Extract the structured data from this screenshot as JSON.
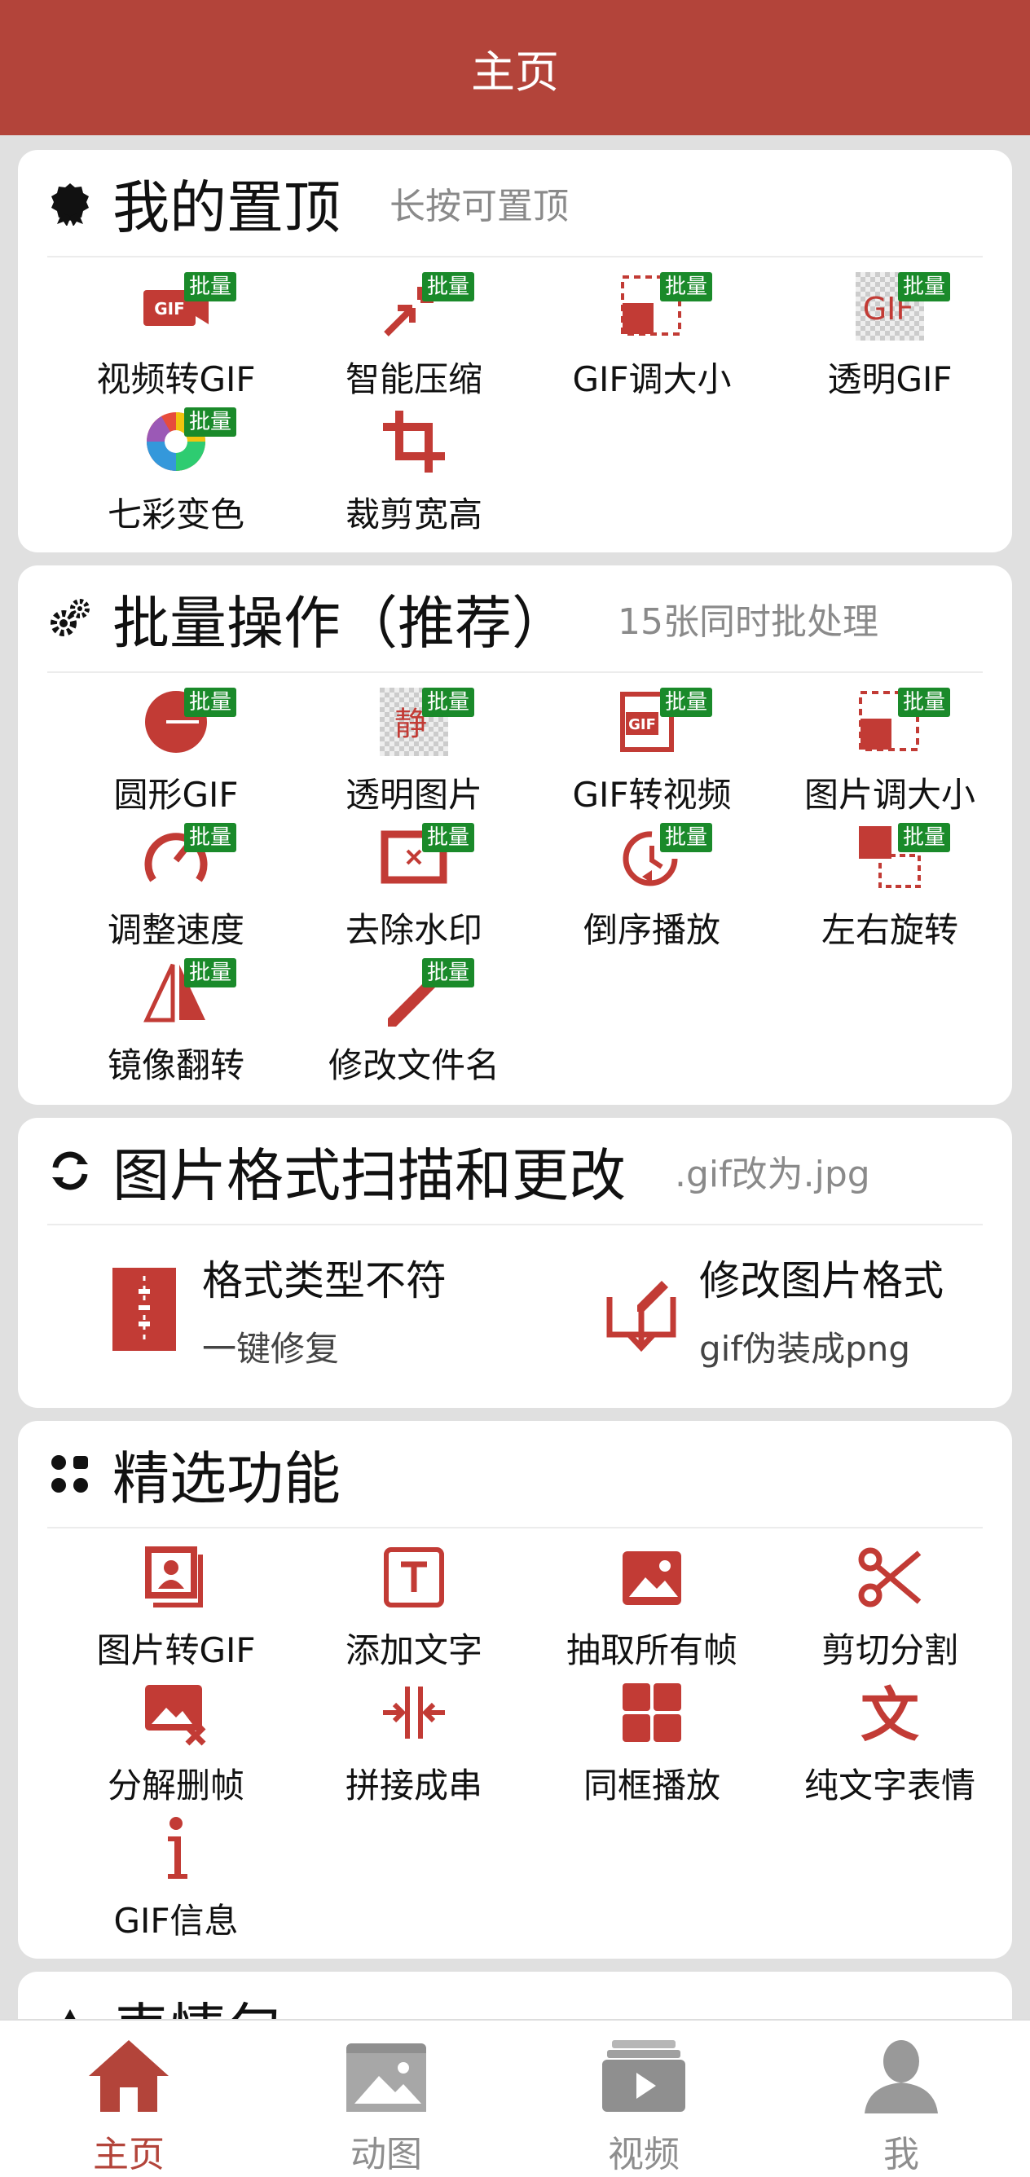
{
  "header": {
    "title": "主页"
  },
  "colors": {
    "accent": "#b3443a",
    "badge": "#1a8a2a"
  },
  "sections": {
    "pinned": {
      "title": "我的置顶",
      "subtitle": "长按可置顶",
      "items": [
        {
          "label": "视频转GIF",
          "badge": "批量",
          "icon": "video-to-gif-icon"
        },
        {
          "label": "智能压缩",
          "badge": "批量",
          "icon": "compress-icon"
        },
        {
          "label": "GIF调大小",
          "badge": "批量",
          "icon": "resize-icon"
        },
        {
          "label": "透明GIF",
          "badge": "批量",
          "icon": "transparent-gif-icon"
        },
        {
          "label": "七彩变色",
          "badge": "批量",
          "icon": "color-wheel-icon"
        },
        {
          "label": "裁剪宽高",
          "badge": "",
          "icon": "crop-icon"
        }
      ]
    },
    "batch": {
      "title": "批量操作（推荐）",
      "subtitle": "15张同时批处理",
      "items": [
        {
          "label": "圆形GIF",
          "badge": "批量",
          "icon": "circle-gif-icon"
        },
        {
          "label": "透明图片",
          "badge": "批量",
          "icon": "transparent-image-icon",
          "glyph": "静"
        },
        {
          "label": "GIF转视频",
          "badge": "批量",
          "icon": "gif-to-video-icon"
        },
        {
          "label": "图片调大小",
          "badge": "批量",
          "icon": "resize-icon"
        },
        {
          "label": "调整速度",
          "badge": "批量",
          "icon": "speed-icon"
        },
        {
          "label": "去除水印",
          "badge": "批量",
          "icon": "remove-watermark-icon"
        },
        {
          "label": "倒序播放",
          "badge": "批量",
          "icon": "reverse-play-icon"
        },
        {
          "label": "左右旋转",
          "badge": "批量",
          "icon": "rotate-icon"
        },
        {
          "label": "镜像翻转",
          "badge": "批量",
          "icon": "mirror-flip-icon"
        },
        {
          "label": "修改文件名",
          "badge": "批量",
          "icon": "rename-icon"
        }
      ]
    },
    "format": {
      "title": "图片格式扫描和更改",
      "subtitle": ".gif改为.jpg",
      "items": [
        {
          "title": "格式类型不符",
          "sub": "一键修复",
          "icon": "zip-file-icon"
        },
        {
          "title": "修改图片格式",
          "sub": "gif伪装成png",
          "icon": "edit-download-icon"
        }
      ]
    },
    "featured": {
      "title": "精选功能",
      "items": [
        {
          "label": "图片转GIF",
          "icon": "photos-icon"
        },
        {
          "label": "添加文字",
          "icon": "text-box-icon"
        },
        {
          "label": "抽取所有帧",
          "icon": "image-icon"
        },
        {
          "label": "剪切分割",
          "icon": "scissors-icon"
        },
        {
          "label": "分解删帧",
          "icon": "image-delete-icon"
        },
        {
          "label": "拼接成串",
          "icon": "join-icon"
        },
        {
          "label": "同框播放",
          "icon": "grid-icon"
        },
        {
          "label": "纯文字表情",
          "icon": "text-char-icon",
          "glyph": "文"
        },
        {
          "label": "GIF信息",
          "icon": "info-icon"
        }
      ]
    },
    "next": {
      "title": "表情包"
    }
  },
  "bottom_nav": [
    {
      "label": "主页",
      "icon": "home-icon",
      "active": true
    },
    {
      "label": "动图",
      "icon": "gallery-folder-icon",
      "active": false
    },
    {
      "label": "视频",
      "icon": "video-folder-icon",
      "active": false
    },
    {
      "label": "我",
      "icon": "profile-icon",
      "active": false
    }
  ]
}
